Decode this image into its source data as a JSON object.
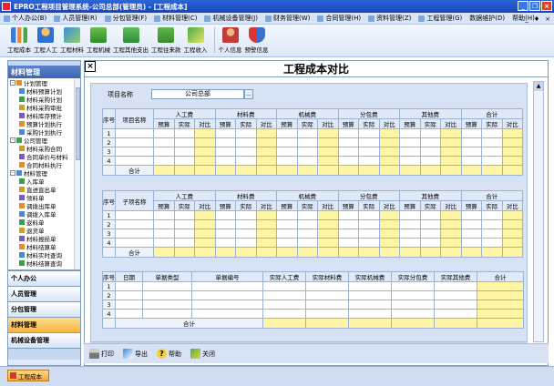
{
  "window": {
    "title": "EPRO工程项目管理系统-公司总部(管理员) - [工程成本]"
  },
  "menu": {
    "items": [
      "个人办公(B)",
      "人员管理(R)",
      "分包管理(F)",
      "材料管理(C)",
      "机械设备管理(J)",
      "财务管理(W)",
      "合同管理(H)",
      "资料管理(Z)",
      "工程管理(G)",
      "数据维护(D)",
      "帮助(H)"
    ],
    "mdi_controls": [
      "_",
      "♦",
      "×"
    ]
  },
  "toolbar": {
    "buttons": [
      "工程成本",
      "工程人工",
      "工程材料",
      "工程机械",
      "工程其他支出",
      "工程往来款",
      "工程收入",
      "个人信息",
      "预警信息"
    ]
  },
  "left_panel": {
    "title": "材料管理",
    "tree": [
      {
        "label": "计划管理",
        "level": 0,
        "expander": "-"
      },
      {
        "label": "材料预算计划",
        "level": 1
      },
      {
        "label": "材料采购计划",
        "level": 1
      },
      {
        "label": "材料采购审批",
        "level": 1
      },
      {
        "label": "材料库存预计",
        "level": 1
      },
      {
        "label": "预算计划执行",
        "level": 1
      },
      {
        "label": "采购计划执行",
        "level": 1
      },
      {
        "label": "公司管理",
        "level": 0,
        "expander": "-"
      },
      {
        "label": "材料采购合同",
        "level": 1
      },
      {
        "label": "合同单价与材料",
        "level": 1
      },
      {
        "label": "合同材料执行",
        "level": 1
      },
      {
        "label": "材料管理",
        "level": 0,
        "expander": "-"
      },
      {
        "label": "入库单",
        "level": 1
      },
      {
        "label": "直进直出单",
        "level": 1
      },
      {
        "label": "领料单",
        "level": 1
      },
      {
        "label": "调拨出库单",
        "level": 1
      },
      {
        "label": "调拨入库单",
        "level": 1
      },
      {
        "label": "返料单",
        "level": 1
      },
      {
        "label": "退货单",
        "level": 1
      },
      {
        "label": "材料报损单",
        "level": 1
      },
      {
        "label": "材料结算单",
        "level": 1
      },
      {
        "label": "材料实时查询",
        "level": 1
      },
      {
        "label": "材料结算查询",
        "level": 1
      }
    ],
    "groups": [
      {
        "label": "个人办公",
        "active": false
      },
      {
        "label": "人员管理",
        "active": false
      },
      {
        "label": "分包管理",
        "active": false
      },
      {
        "label": "材料管理",
        "active": true
      },
      {
        "label": "机械设备管理",
        "active": false
      }
    ]
  },
  "main": {
    "close_glyph": "×",
    "heading": "工程成本对比",
    "project": {
      "label": "项目名称",
      "value": "公司总部",
      "browse": "..."
    },
    "table1": {
      "col_no": "序号",
      "col_name": "项目名称",
      "groups": [
        "人工费",
        "材料费",
        "机械费",
        "分包费",
        "其他费",
        "合计"
      ],
      "sub": [
        "预算",
        "实际",
        "对比"
      ],
      "rows": [
        "1",
        "2",
        "3",
        "4"
      ],
      "total": "合计"
    },
    "table2": {
      "col_no": "序号",
      "col_name": "子项名称",
      "groups": [
        "人工费",
        "材料费",
        "机械费",
        "分包费",
        "其他费",
        "合计"
      ],
      "sub": [
        "预算",
        "实际",
        "对比"
      ],
      "rows": [
        "1",
        "2",
        "3",
        "4"
      ],
      "total": "合计"
    },
    "table3": {
      "headers": [
        "序号",
        "日期",
        "单据类型",
        "单据编号",
        "实际人工费",
        "实际材料费",
        "实际机械费",
        "实际分包费",
        "实际其他费",
        "合计"
      ],
      "rows": [
        "1",
        "2",
        "3",
        "4"
      ],
      "total": "合计"
    }
  },
  "bottom_toolbar": {
    "buttons": [
      "打印",
      "导出",
      "帮助",
      "关闭"
    ]
  },
  "taskbar": {
    "task": "工程成本"
  },
  "colors": {
    "title_bar": "#1d52c4",
    "highlight": "#fdf5a3",
    "panel": "#d7e3f5",
    "active_group": "#f8b340"
  }
}
